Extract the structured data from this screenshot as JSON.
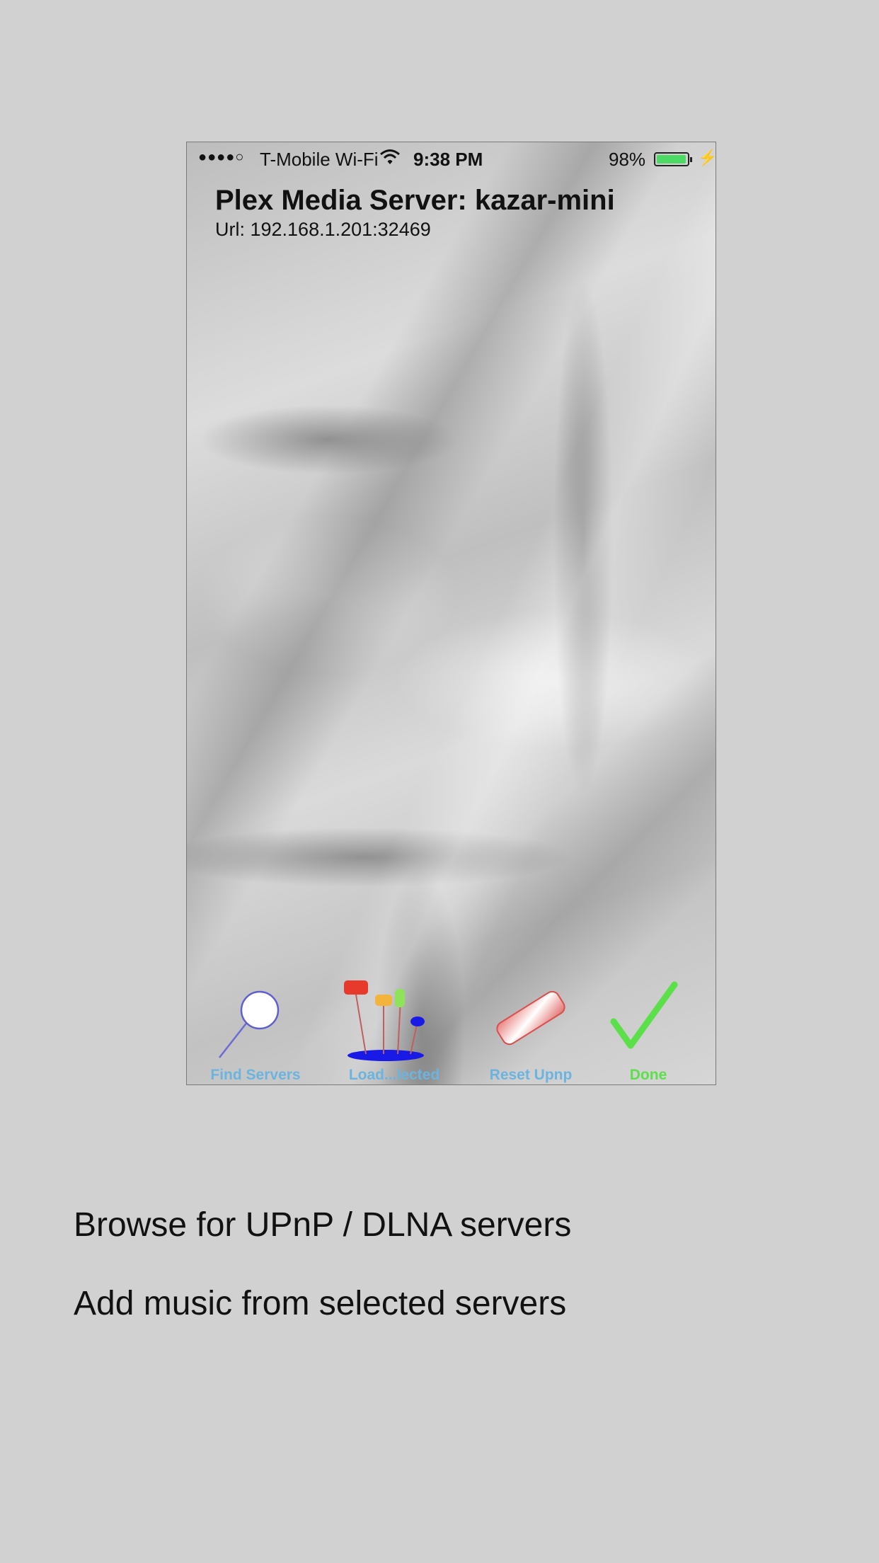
{
  "status_bar": {
    "signal": "●●●●○",
    "carrier": "T-Mobile Wi-Fi",
    "time": "9:38 PM",
    "battery_percent": "98%",
    "battery_level": 0.98,
    "wifi_icon": "wifi-icon",
    "charging_icon": "charging-bolt-icon"
  },
  "header": {
    "title": "Plex Media Server: kazar-mini",
    "url": "Url: 192.168.1.201:32469"
  },
  "toolbar": {
    "find_servers": {
      "label": "Find Servers",
      "icon": "magnifier-icon",
      "color": "#6cb4e0"
    },
    "load_selected": {
      "label": "Load...lected",
      "icon": "pins-icon",
      "color": "#6cb4e0"
    },
    "reset_upnp": {
      "label": "Reset Upnp",
      "icon": "eraser-icon",
      "color": "#6cb4e0"
    },
    "done": {
      "label": "Done",
      "icon": "checkmark-icon",
      "color": "#5ce04a"
    }
  },
  "captions": {
    "browse": "Browse for UPnP / DLNA servers",
    "add_music": "Add music from selected servers"
  },
  "colors": {
    "background": "#d1d1d1",
    "battery_fill": "#4cd964",
    "done_green": "#5ce04a",
    "label_blue": "#6cb4e0"
  }
}
